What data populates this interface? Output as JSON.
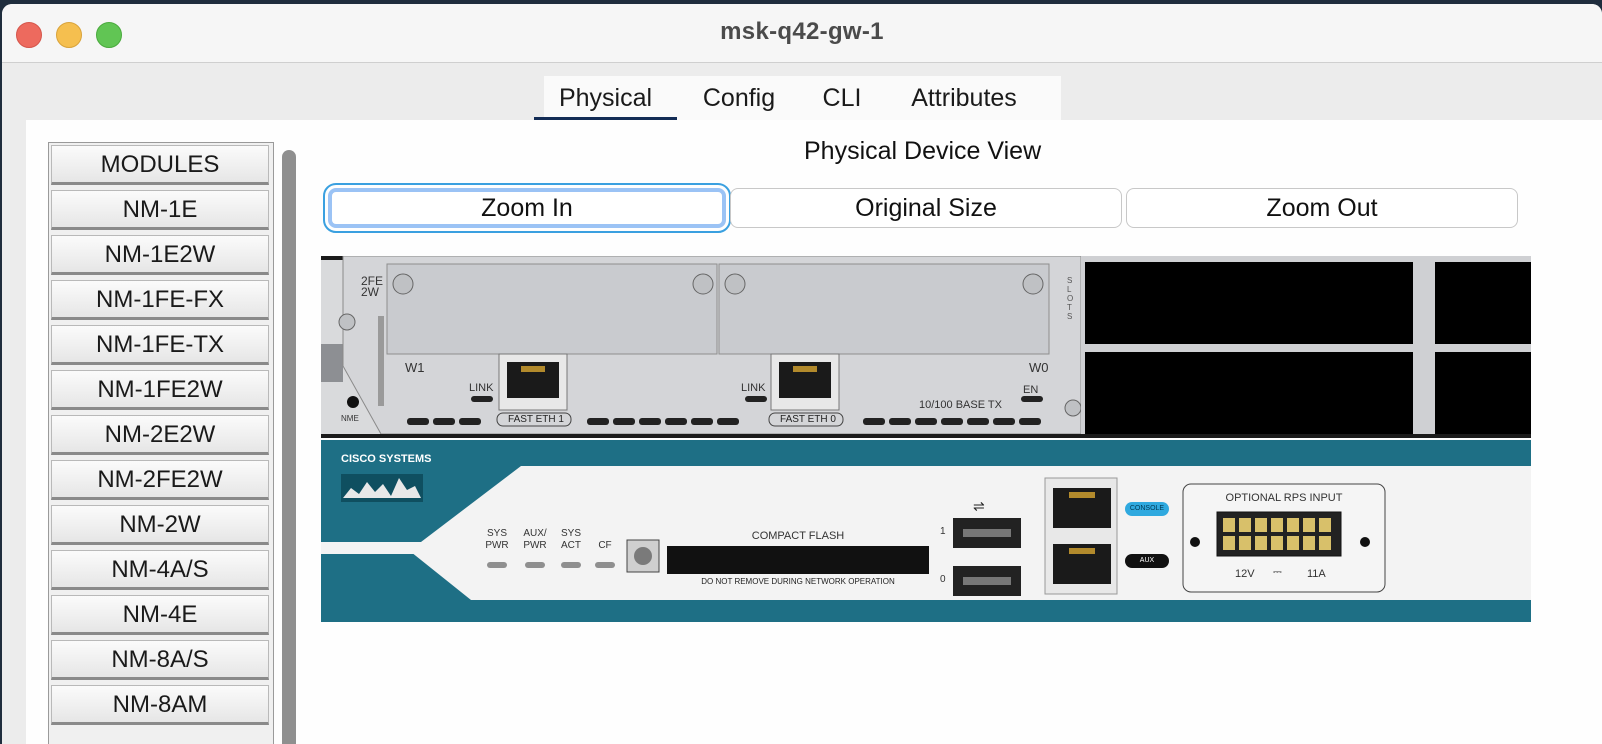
{
  "window": {
    "title": "msk-q42-gw-1"
  },
  "tabs": [
    {
      "label": "Physical",
      "active": true
    },
    {
      "label": "Config",
      "active": false
    },
    {
      "label": "CLI",
      "active": false
    },
    {
      "label": "Attributes",
      "active": false
    }
  ],
  "modules": {
    "header": "MODULES",
    "items": [
      "NM-1E",
      "NM-1E2W",
      "NM-1FE-FX",
      "NM-1FE-TX",
      "NM-1FE2W",
      "NM-2E2W",
      "NM-2FE2W",
      "NM-2W",
      "NM-4A/S",
      "NM-4E",
      "NM-8A/S",
      "NM-8AM"
    ]
  },
  "physical_view": {
    "title": "Physical Device View",
    "zoom_in": "Zoom In",
    "original_size": "Original Size",
    "zoom_out": "Zoom Out"
  },
  "device": {
    "module_label": "2FE 2W",
    "slot_w1": "W1",
    "slot_w0": "W0",
    "link_1": "LINK",
    "link_0": "LINK",
    "fast_eth_1": "FAST ETH 1",
    "fast_eth_0": "FAST ETH 0",
    "base_tx": "10/100 BASE TX",
    "en": "EN",
    "nme": "NME",
    "slots": "SLOTS",
    "brand": "CISCO SYSTEMS",
    "led_sys_pwr": "SYS PWR",
    "led_aux_pwr": "AUX/ PWR",
    "led_sys_act": "SYS ACT",
    "led_cf": "CF",
    "compact_flash": "COMPACT FLASH",
    "cf_warning": "DO NOT REMOVE DURING NETWORK OPERATION",
    "usb_1": "1",
    "usb_0": "0",
    "console": "CONSOLE",
    "aux": "AUX",
    "rps_title": "OPTIONAL RPS INPUT",
    "rps_voltage": "12V",
    "rps_current": "11A"
  },
  "colors": {
    "tab_active_underline": "#132c55",
    "chassis_teal": "#1e6f85",
    "focus_ring": "#3aa0e0",
    "console_port": "#2fa9df"
  }
}
